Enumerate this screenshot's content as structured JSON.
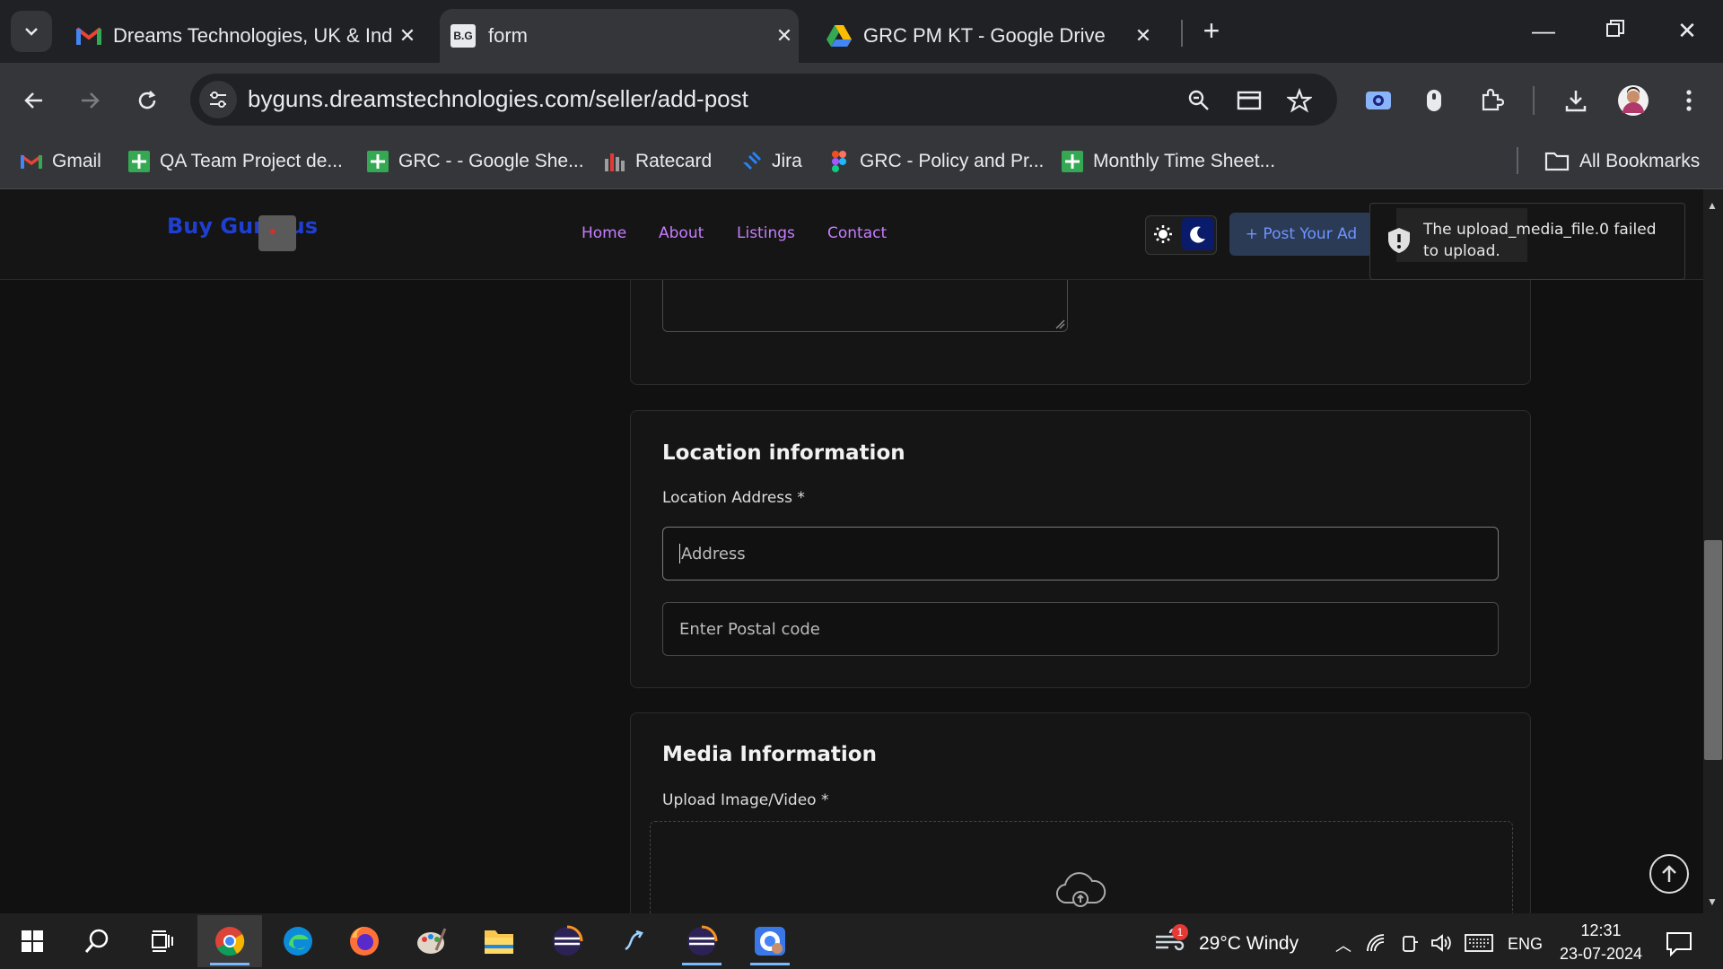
{
  "browser": {
    "tabs": [
      {
        "title": "Dreams Technologies, UK & Ind",
        "icon": "gmail-icon"
      },
      {
        "title": "form",
        "icon": "bg-favicon"
      },
      {
        "title": "GRC PM KT - Google Drive",
        "icon": "google-drive-icon"
      }
    ],
    "url": "byguns.dreamstechnologies.com/seller/add-post",
    "bookmarks": [
      {
        "label": "Gmail",
        "icon": "gmail-icon"
      },
      {
        "label": "QA Team Project de...",
        "icon": "sheets-icon"
      },
      {
        "label": "GRC - - Google She...",
        "icon": "sheets-icon"
      },
      {
        "label": "Ratecard",
        "icon": "ratecard-icon"
      },
      {
        "label": "Jira",
        "icon": "jira-icon"
      },
      {
        "label": "GRC - Policy and Pr...",
        "icon": "figma-icon"
      },
      {
        "label": "Monthly Time Sheet...",
        "icon": "sheets-icon"
      }
    ],
    "all_bookmarks": "All Bookmarks"
  },
  "site": {
    "logo": "Buy Guns.us",
    "nav": [
      "Home",
      "About",
      "Listings",
      "Contact"
    ],
    "post_ad": "+ Post Your Ad",
    "toast": "The upload_media_file.0 failed to upload."
  },
  "form": {
    "location": {
      "title": "Location information",
      "address_label": "Location Address *",
      "address_placeholder": "Address",
      "postal_placeholder": "Enter Postal code"
    },
    "media": {
      "title": "Media Information",
      "upload_label": "Upload Image/Video *"
    }
  },
  "taskbar": {
    "weather": "29°C  Windy",
    "weather_badge": "1",
    "lang": "ENG",
    "time": "12:31",
    "date": "23-07-2024"
  }
}
